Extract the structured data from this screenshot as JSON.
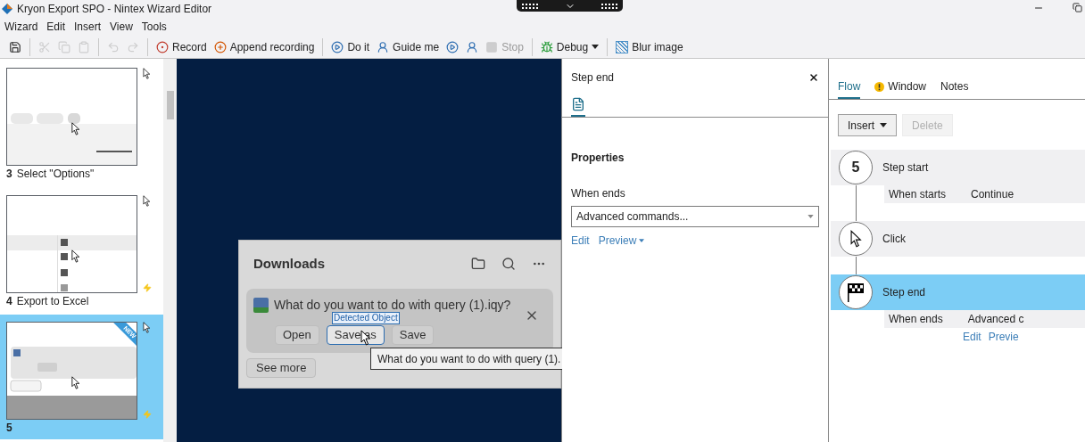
{
  "window": {
    "title": "Kryon Export SPO - Nintex Wizard Editor"
  },
  "menu": [
    "Wizard",
    "Edit",
    "Insert",
    "View",
    "Tools"
  ],
  "toolbar": [
    {
      "kind": "icon",
      "disabled": false
    },
    {
      "kind": "separator"
    },
    {
      "kind": "icon",
      "disabled": true
    },
    {
      "kind": "icon",
      "disabled": true
    },
    {
      "kind": "icon",
      "disabled": true
    },
    {
      "kind": "separator"
    },
    {
      "kind": "icon",
      "disabled": true
    },
    {
      "kind": "icon",
      "disabled": true
    },
    {
      "kind": "separator"
    },
    {
      "kind": "button",
      "label": "Record",
      "disabled": false
    },
    {
      "kind": "button",
      "label": "Append recording",
      "disabled": false
    },
    {
      "kind": "separator"
    },
    {
      "kind": "button",
      "label": "Do it",
      "disabled": false
    },
    {
      "kind": "button",
      "label": "Guide me",
      "disabled": false
    },
    {
      "kind": "icon",
      "disabled": false
    },
    {
      "kind": "icon",
      "disabled": false
    },
    {
      "kind": "button",
      "label": "Stop",
      "disabled": true
    },
    {
      "kind": "separator"
    },
    {
      "kind": "dropdown",
      "label": "Debug",
      "disabled": false
    },
    {
      "kind": "separator"
    },
    {
      "kind": "button",
      "label": "Blur image",
      "disabled": false
    }
  ],
  "steps": [
    {
      "number": "3",
      "label": "Select \"Options\"",
      "selected": false,
      "flagged": false,
      "thumbnail": {
        "kind": "toolbar"
      }
    },
    {
      "number": "4",
      "label": "Export to Excel",
      "selected": false,
      "flagged": true,
      "thumbnail": {
        "kind": "menu"
      }
    },
    {
      "number": "5",
      "selected": true,
      "flagged": true,
      "badge": "NEW",
      "thumbnail": {
        "kind": "dialog"
      }
    }
  ],
  "canvas": {
    "dialog": {
      "title": "Downloads",
      "question": "What do you want to do with query (1).iqy?",
      "buttons": [
        "Open",
        "Save as",
        "Save"
      ],
      "detected_label": "Detected Object",
      "tooltip": "What do you want to do with query (1).",
      "see_more": "See more"
    }
  },
  "properties": {
    "title": "Step end",
    "section": "Properties",
    "field_label": "When ends",
    "field_value": "Advanced commands...",
    "links": [
      "Edit",
      "Preview"
    ]
  },
  "flow": {
    "tabs": [
      {
        "label": "Flow",
        "selected": true,
        "warning": false
      },
      {
        "label": "Window",
        "selected": false,
        "warning": true
      },
      {
        "label": "Notes",
        "selected": false,
        "warning": false
      }
    ],
    "buttons": [
      {
        "label": "Insert",
        "disabled": false
      },
      {
        "label": "Delete",
        "disabled": true
      }
    ],
    "steps": [
      {
        "kind": "number",
        "number": "5",
        "title": "Step start",
        "selected": false,
        "detail": {
          "label": "When starts",
          "value": "Continue"
        }
      },
      {
        "kind": "click",
        "title": "Click",
        "selected": false
      },
      {
        "kind": "end",
        "title": "Step end",
        "selected": true,
        "detail": {
          "label": "When ends",
          "value": "Advanced c"
        },
        "links": [
          "Edit",
          "Previe"
        ]
      }
    ]
  }
}
